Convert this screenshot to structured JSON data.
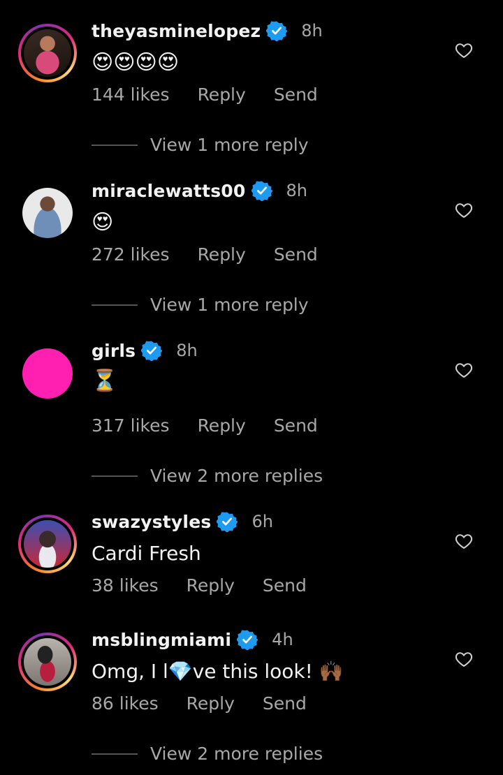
{
  "comments": [
    {
      "username": "theyasminelopez",
      "time": "8h",
      "text": "😍😍😍😍",
      "likes": "144 likes",
      "reply": "Reply",
      "send": "Send",
      "view_more": "View 1 more reply"
    },
    {
      "username": "miraclewatts00",
      "time": "8h",
      "text": "😍",
      "likes": "272 likes",
      "reply": "Reply",
      "send": "Send",
      "view_more": "View 1 more reply"
    },
    {
      "username": "girls",
      "time": "8h",
      "text": "⏳",
      "likes": "317 likes",
      "reply": "Reply",
      "send": "Send",
      "view_more": "View 2 more replies"
    },
    {
      "username": "swazystyles",
      "time": "6h",
      "text": "Cardi Fresh",
      "likes": "38 likes",
      "reply": "Reply",
      "send": "Send"
    },
    {
      "username": "msblingmiami",
      "time": "4h",
      "text": "Omg, I l💎ve this look! 🙌🏾",
      "likes": "86 likes",
      "reply": "Reply",
      "send": "Send",
      "view_more": "View 2 more replies"
    }
  ],
  "colors": {
    "background": "#000000",
    "verified": "#1d9bf0",
    "girls_avatar": "#ff1fb0"
  }
}
